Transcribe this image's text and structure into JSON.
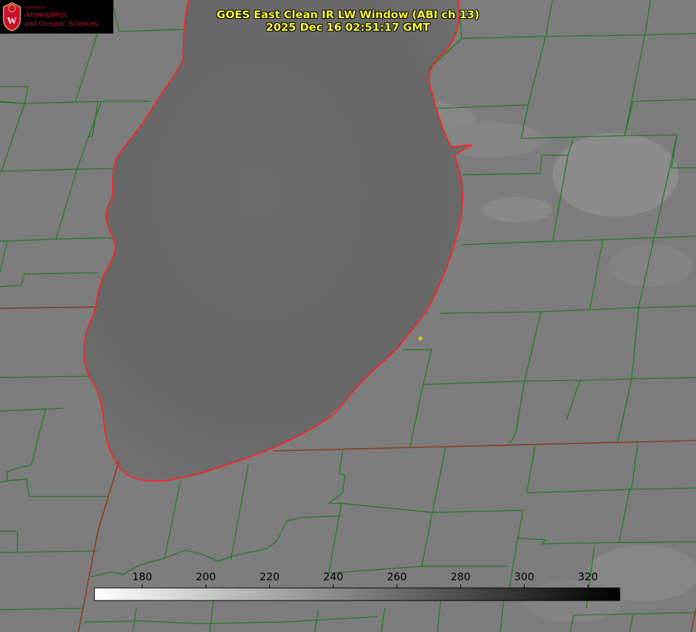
{
  "logo": {
    "small_text": "Department of",
    "line1": "Atmospheric",
    "line2": "and Oceanic Sciences",
    "seal_letter": "W"
  },
  "title": {
    "line1": "GOES East Clean IR LW Window (ABI ch 13)",
    "line2": "2025 Dec 16 02:51:17 GMT"
  },
  "colorbar": {
    "ticks": [
      "180",
      "200",
      "220",
      "240",
      "260",
      "280",
      "300",
      "320"
    ],
    "tick_values": [
      180,
      200,
      220,
      240,
      260,
      280,
      300,
      320
    ],
    "range": [
      165,
      330
    ],
    "gradient": "white to black"
  },
  "colors": {
    "county_lines": "#1f7a1f",
    "state_lines": "#8b3a1a",
    "lake_outline": "#ff2020",
    "title_text": "#ffff33",
    "marker": "#d4c21a",
    "background": "#7c7c7c",
    "lake_fill": "#6a6a6a"
  }
}
